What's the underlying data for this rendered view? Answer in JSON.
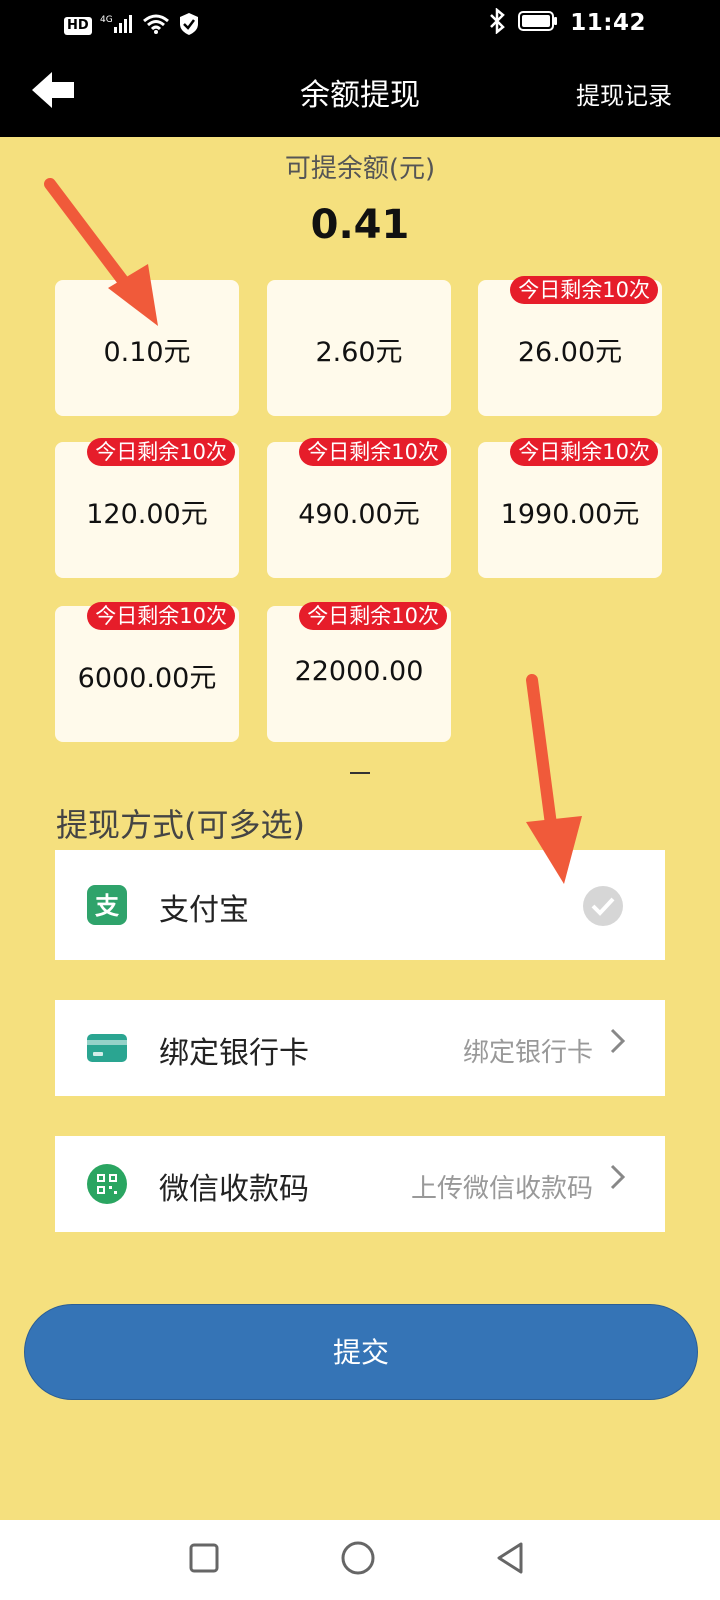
{
  "status_bar": {
    "network": "HD",
    "signal": "4G",
    "time": "11:42"
  },
  "header": {
    "back_icon": "back-arrow-icon",
    "title": "余额提现",
    "record_label": "提现记录"
  },
  "balance": {
    "label": "可提余额(元)",
    "value": "0.41"
  },
  "amount_options": [
    {
      "amount": "0.10元",
      "badge": ""
    },
    {
      "amount": "2.60元",
      "badge": ""
    },
    {
      "amount": "26.00元",
      "badge": "今日剩余10次"
    },
    {
      "amount": "120.00元",
      "badge": "今日剩余10次"
    },
    {
      "amount": "490.00元",
      "badge": "今日剩余10次"
    },
    {
      "amount": "1990.00元",
      "badge": "今日剩余10次"
    },
    {
      "amount": "6000.00元",
      "badge": "今日剩余10次"
    },
    {
      "amount": "22000.00",
      "badge": "今日剩余10次"
    }
  ],
  "methods": {
    "title": "提现方式(可多选)",
    "alipay": {
      "label": "支付宝",
      "icon": "alipay-icon",
      "selected": true
    },
    "bank": {
      "label": "绑定银行卡",
      "action": "绑定银行卡",
      "icon": "bank-card-icon"
    },
    "wechat": {
      "label": "微信收款码",
      "action": "上传微信收款码",
      "icon": "qr-code-icon"
    }
  },
  "submit_label": "提交",
  "colors": {
    "background": "#f5e07e",
    "header": "#000000",
    "badge": "#e61d2a",
    "submit": "#3574b6",
    "alipay": "#2fa36b",
    "annotation_arrow": "#f05a3a"
  },
  "nav_icons": [
    "recents-square-icon",
    "home-circle-icon",
    "back-triangle-icon"
  ]
}
